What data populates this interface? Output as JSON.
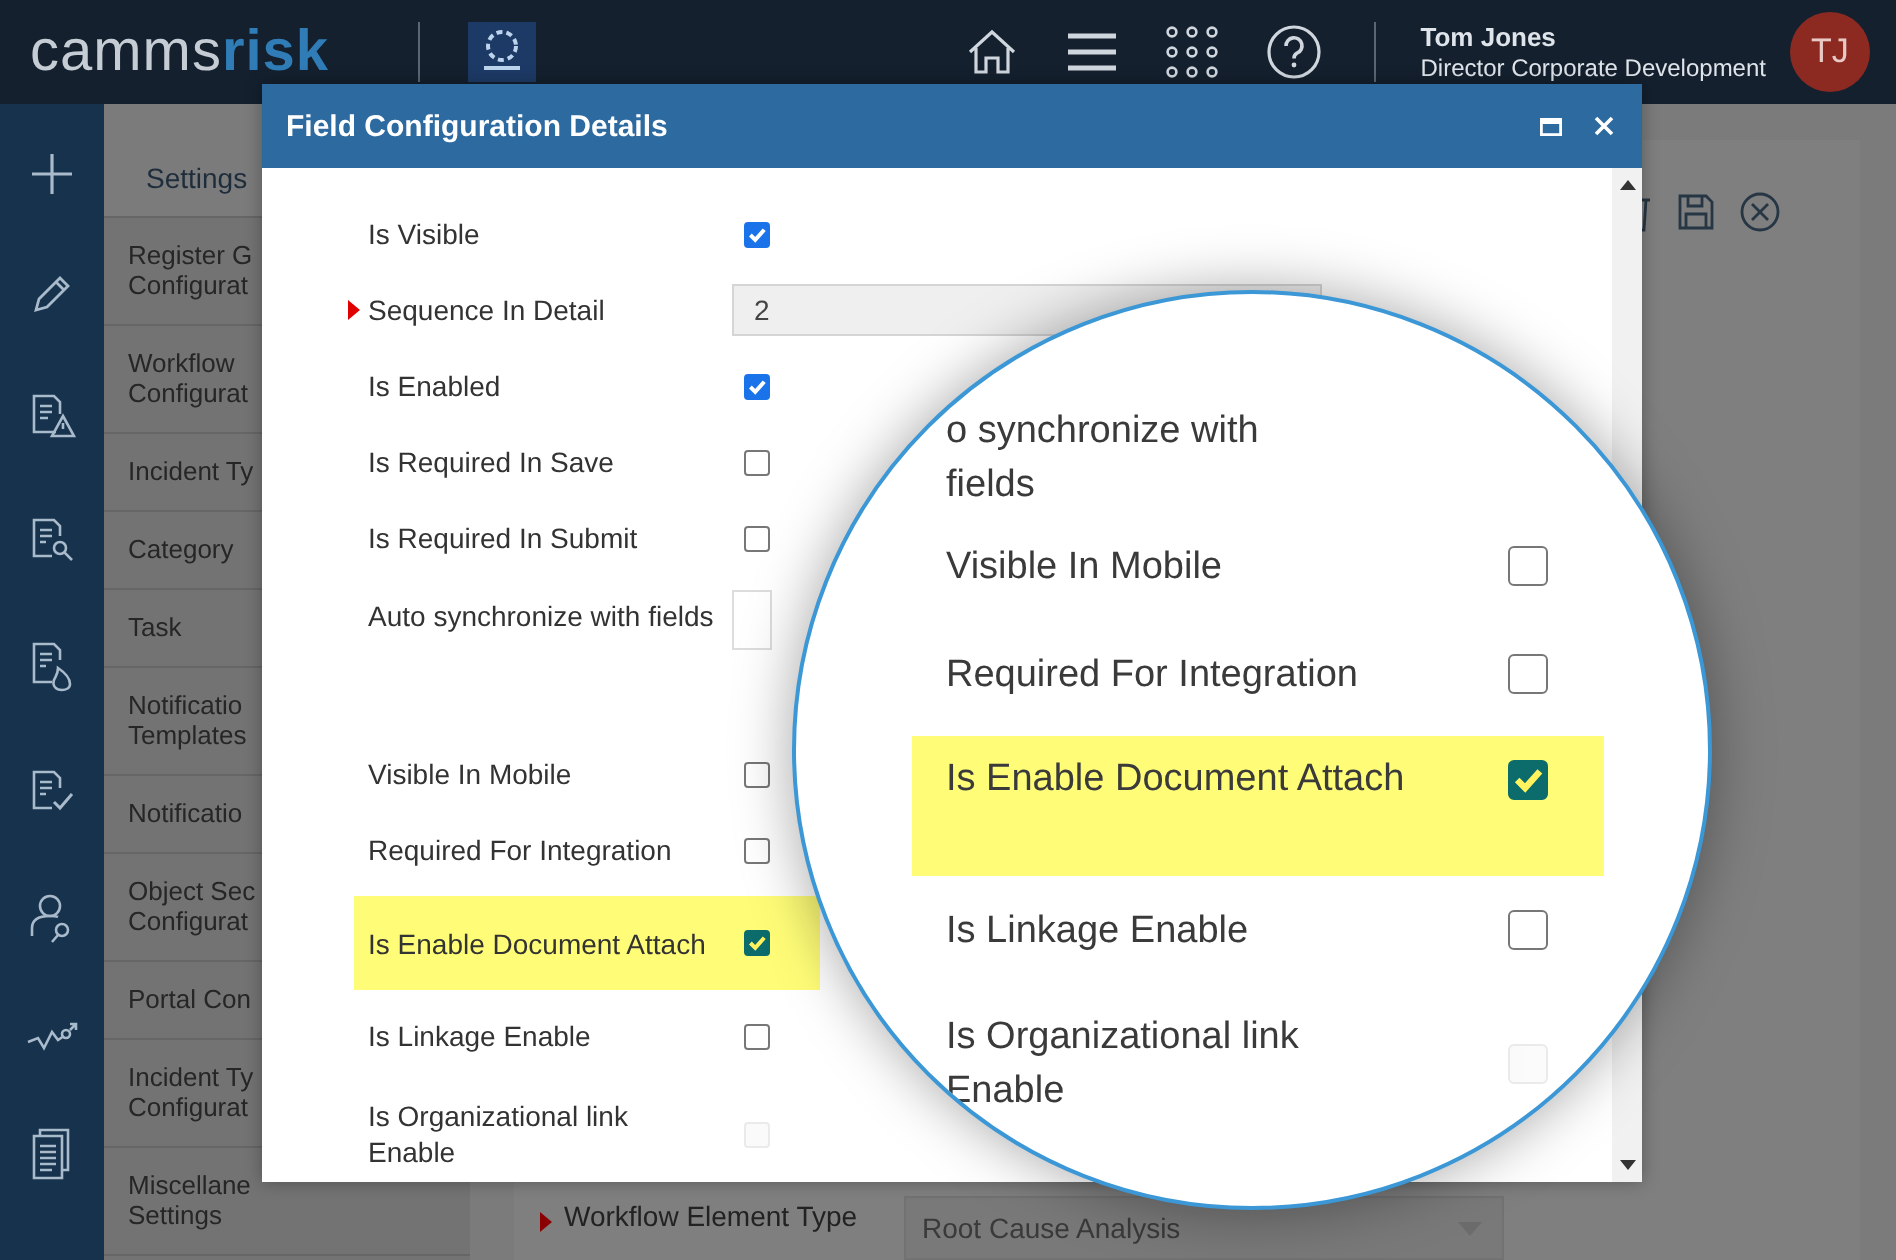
{
  "header": {
    "logo": {
      "main": "camms",
      "accent": "risk"
    },
    "user": {
      "name": "Tom Jones",
      "role": "Director Corporate Development",
      "initials": "TJ"
    }
  },
  "settings_menu": {
    "title": "Settings",
    "items": [
      {
        "lines": [
          "Register G",
          "Configurat"
        ]
      },
      {
        "lines": [
          "Workflow",
          "Configurat"
        ]
      },
      {
        "lines": [
          "Incident Ty"
        ]
      },
      {
        "lines": [
          "Category"
        ]
      },
      {
        "lines": [
          "Task"
        ]
      },
      {
        "lines": [
          "Notificatio",
          "Templates"
        ]
      },
      {
        "lines": [
          "Notificatio"
        ]
      },
      {
        "lines": [
          "Object Sec",
          "Configurat"
        ]
      },
      {
        "lines": [
          "Portal Con"
        ]
      },
      {
        "lines": [
          "Incident Ty",
          "Configurat"
        ]
      },
      {
        "lines": [
          "Miscellane",
          "Settings"
        ]
      }
    ]
  },
  "background_form": {
    "label": "Workflow Element Type",
    "required": true,
    "value": "Root Cause Analysis"
  },
  "dialog": {
    "title": "Field Configuration Details",
    "rows": [
      {
        "kind": "checkbox",
        "label": "Is Visible",
        "checked": true,
        "disabled": false,
        "required": false,
        "highlighted": false
      },
      {
        "kind": "text",
        "label": "Sequence In Detail",
        "value": "2",
        "required": true,
        "highlighted": false
      },
      {
        "kind": "checkbox",
        "label": "Is Enabled",
        "checked": true,
        "disabled": false,
        "required": false,
        "highlighted": false
      },
      {
        "kind": "checkbox",
        "label": "Is Required In Save",
        "checked": false,
        "disabled": false,
        "required": false,
        "highlighted": false
      },
      {
        "kind": "checkbox",
        "label": "Is Required In Submit",
        "checked": false,
        "disabled": false,
        "required": false,
        "highlighted": false
      },
      {
        "kind": "box",
        "label": "Auto synchronize with fields",
        "required": false,
        "highlighted": false
      },
      {
        "kind": "checkbox",
        "label": "Visible In Mobile",
        "checked": false,
        "disabled": false,
        "required": false,
        "highlighted": false
      },
      {
        "kind": "checkbox",
        "label": "Required For Integration",
        "checked": false,
        "disabled": false,
        "required": false,
        "highlighted": false
      },
      {
        "kind": "checkbox",
        "label": "Is Enable Document Attach",
        "checked": true,
        "disabled": false,
        "required": false,
        "highlighted": true
      },
      {
        "kind": "checkbox",
        "label": "Is Linkage Enable",
        "checked": false,
        "disabled": false,
        "required": false,
        "highlighted": false
      },
      {
        "kind": "checkbox",
        "label": "Is Organizational link Enable",
        "checked": false,
        "disabled": true,
        "required": false,
        "highlighted": false
      }
    ]
  },
  "magnifier": {
    "rows": [
      {
        "kind": "box",
        "label": "o synchronize with fields",
        "highlighted": false
      },
      {
        "kind": "checkbox",
        "label": "Visible In Mobile",
        "checked": false,
        "disabled": false,
        "highlighted": false
      },
      {
        "kind": "checkbox",
        "label": "Required For Integration",
        "checked": false,
        "disabled": false,
        "highlighted": false
      },
      {
        "kind": "checkbox",
        "label": "Is Enable Document Attach",
        "checked": true,
        "disabled": false,
        "highlighted": true
      },
      {
        "kind": "checkbox",
        "label": "Is Linkage Enable",
        "checked": false,
        "disabled": false,
        "highlighted": false
      },
      {
        "kind": "checkbox",
        "label": "Is Organizational link Enable",
        "checked": false,
        "disabled": true,
        "highlighted": false
      }
    ]
  }
}
